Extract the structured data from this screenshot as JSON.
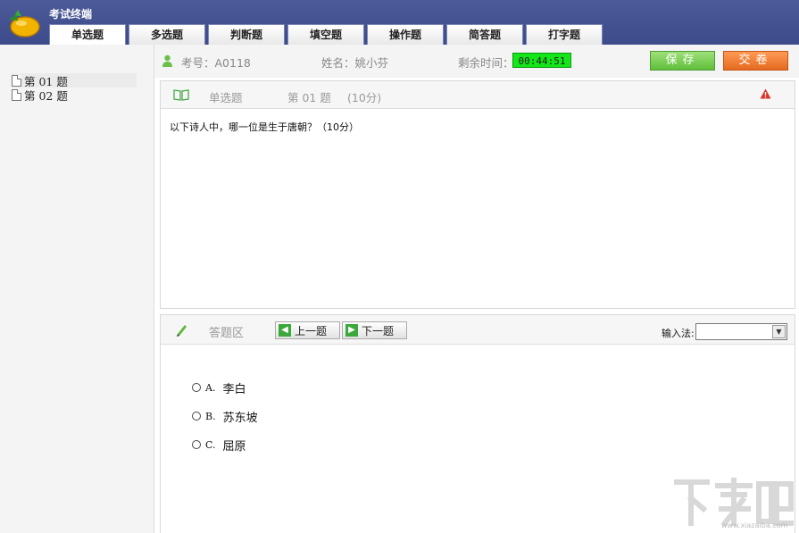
{
  "app": {
    "title": "考试终端"
  },
  "tabs": [
    {
      "label": "单选题",
      "active": true
    },
    {
      "label": "多选题"
    },
    {
      "label": "判断题"
    },
    {
      "label": "填空题"
    },
    {
      "label": "操作题"
    },
    {
      "label": "简答题"
    },
    {
      "label": "打字题"
    }
  ],
  "question_list": [
    {
      "label": "第 01 题",
      "selected": true
    },
    {
      "label": "第 02 题"
    }
  ],
  "info": {
    "exam_id": "考号：A0118",
    "name": "姓名：姚小芬",
    "time_label": "剩余时间：",
    "time_value": "00:44:51",
    "save_label": "保存",
    "submit_label": "交卷"
  },
  "question": {
    "type": "单选题",
    "number": "第 01 题",
    "score": "(10分)",
    "text": "以下诗人中，哪一位是生于唐朝？（10分）"
  },
  "answer": {
    "label": "答题区",
    "prev_label": "上一题",
    "next_label": "下一题",
    "ime_label": "输入法:",
    "ime_value": "",
    "options": [
      {
        "letter": "A.",
        "text": "李白"
      },
      {
        "letter": "B.",
        "text": "苏东坡"
      },
      {
        "letter": "C.",
        "text": "屈原"
      }
    ]
  },
  "watermark": {
    "text": "下载吧",
    "url": "www.xiazaiba.com"
  },
  "colors": {
    "titlebar": "#3d4b8a",
    "timer": "#14e61a",
    "save": "#5fbf3a",
    "submit": "#e56a1f"
  }
}
